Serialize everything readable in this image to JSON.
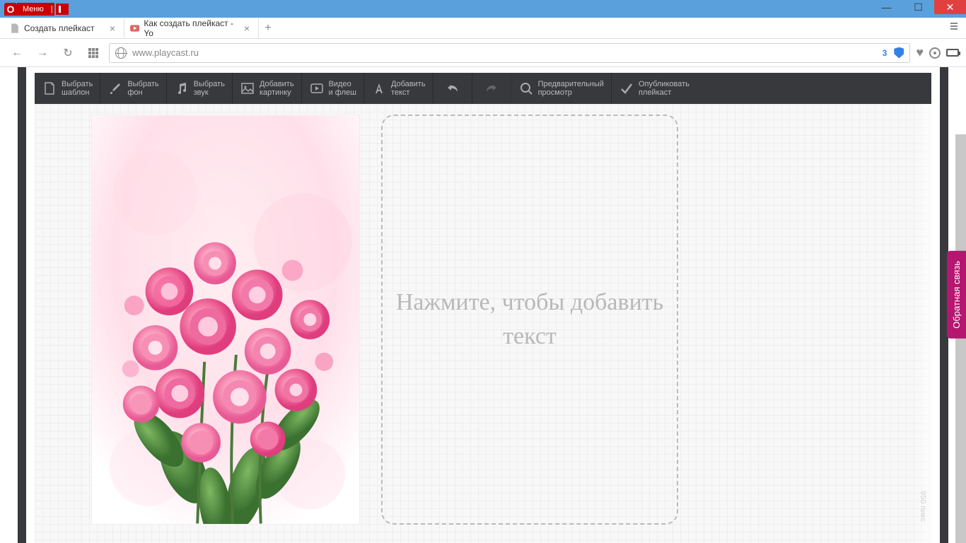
{
  "browser": {
    "menu_label": "Меню",
    "tabs": [
      {
        "title": "Создать плейкаст",
        "active": true,
        "icon": "document"
      },
      {
        "title": "Как создать плейкаст - Yo",
        "active": false,
        "icon": "youtube"
      }
    ],
    "url": "www.playcast.ru",
    "badge_count": "3"
  },
  "toolbar": {
    "items": [
      {
        "line1": "Выбрать",
        "line2": "шаблон",
        "icon": "template"
      },
      {
        "line1": "Выбрать",
        "line2": "фон",
        "icon": "brush"
      },
      {
        "line1": "Выбрать",
        "line2": "звук",
        "icon": "music"
      },
      {
        "line1": "Добавить",
        "line2": "картинку",
        "icon": "image"
      },
      {
        "line1": "Видео",
        "line2": "и флеш",
        "icon": "video"
      },
      {
        "line1": "Добавить",
        "line2": "текст",
        "icon": "text"
      },
      {
        "line1": "",
        "line2": "",
        "icon": "undo"
      },
      {
        "line1": "",
        "line2": "",
        "icon": "redo"
      },
      {
        "line1": "Предварительный",
        "line2": "просмотр",
        "icon": "preview"
      },
      {
        "line1": "Опубликовать",
        "line2": "плейкаст",
        "icon": "publish"
      }
    ]
  },
  "canvas": {
    "text_placeholder": "Нажмите, чтобы добавить текст",
    "ruler_label": "950 пикс"
  },
  "feedback_label": "Обратная связь"
}
